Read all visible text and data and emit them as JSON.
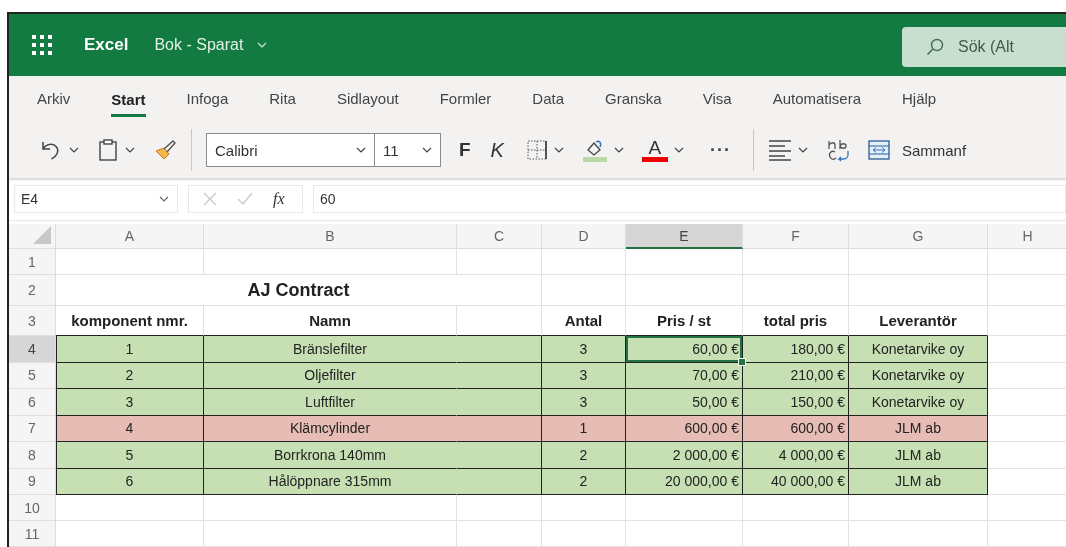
{
  "title_bar": {
    "app_name": "Excel",
    "document": "Bok - Sparat",
    "search": {
      "placeholder": "Sök (Alt"
    }
  },
  "ribbon_tabs": [
    {
      "label": "Arkiv",
      "selected": false
    },
    {
      "label": "Start",
      "selected": true
    },
    {
      "label": "Infoga",
      "selected": false
    },
    {
      "label": "Rita",
      "selected": false
    },
    {
      "label": "Sidlayout",
      "selected": false
    },
    {
      "label": "Formler",
      "selected": false
    },
    {
      "label": "Data",
      "selected": false
    },
    {
      "label": "Granska",
      "selected": false
    },
    {
      "label": "Visa",
      "selected": false
    },
    {
      "label": "Automatisera",
      "selected": false
    },
    {
      "label": "Hjälp",
      "selected": false
    }
  ],
  "toolbar": {
    "font": "Calibri",
    "font_size": "11",
    "bold": "F",
    "italic": "K",
    "font_color": "A",
    "more": "···",
    "merge": "Sammanf"
  },
  "formula_bar": {
    "name_box": "E4",
    "fx": "fx",
    "value": "60"
  },
  "sheet": {
    "columns": [
      {
        "label": "A",
        "selected": false
      },
      {
        "label": "B",
        "selected": false
      },
      {
        "label": "C",
        "selected": false
      },
      {
        "label": "D",
        "selected": false
      },
      {
        "label": "E",
        "selected": true
      },
      {
        "label": "F",
        "selected": false
      },
      {
        "label": "G",
        "selected": false
      },
      {
        "label": "H",
        "selected": false
      }
    ],
    "rows": [
      {
        "label": "1",
        "kind": "empty",
        "selected": false
      },
      {
        "label": "2",
        "kind": "title",
        "selected": false,
        "cells": {
          "A": "AJ Contract"
        }
      },
      {
        "label": "3",
        "kind": "header",
        "selected": false,
        "cells": {
          "A": "komponent nmr.",
          "B": "Namn",
          "D": "Antal",
          "E": "Pris / st",
          "F": "total pris",
          "G": "Leverantör"
        }
      },
      {
        "label": "4",
        "kind": "data",
        "selected": true,
        "color": "#c6e0b4",
        "cells": {
          "A": "1",
          "B": "Bränslefilter",
          "D": "3",
          "E": "60,00 €",
          "F": "180,00 €",
          "G": "Konetarvike oy"
        }
      },
      {
        "label": "5",
        "kind": "data",
        "selected": false,
        "color": "#c6e0b4",
        "cells": {
          "A": "2",
          "B": "Oljefilter",
          "D": "3",
          "E": "70,00 €",
          "F": "210,00 €",
          "G": "Konetarvike oy"
        }
      },
      {
        "label": "6",
        "kind": "data",
        "selected": false,
        "color": "#c6e0b4",
        "cells": {
          "A": "3",
          "B": "Luftfilter",
          "D": "3",
          "E": "50,00 €",
          "F": "150,00 €",
          "G": "Konetarvike oy"
        }
      },
      {
        "label": "7",
        "kind": "data",
        "selected": false,
        "color": "#e6bcb5",
        "cells": {
          "A": "4",
          "B": "Klämcylinder",
          "D": "1",
          "E": "600,00 €",
          "F": "600,00 €",
          "G": "JLM ab"
        }
      },
      {
        "label": "8",
        "kind": "data",
        "selected": false,
        "color": "#c6e0b4",
        "cells": {
          "A": "5",
          "B": "Borrkrona 140mm",
          "D": "2",
          "E": "2 000,00 €",
          "F": "4 000,00 €",
          "G": "JLM ab"
        }
      },
      {
        "label": "9",
        "kind": "data",
        "selected": false,
        "color": "#c6e0b4",
        "cells": {
          "A": "6",
          "B": "Hålöppnare 315mm",
          "D": "2",
          "E": "20 000,00 €",
          "F": "40 000,00 €",
          "G": "JLM ab"
        }
      },
      {
        "label": "10",
        "kind": "empty",
        "selected": false
      },
      {
        "label": "11",
        "kind": "empty",
        "selected": false
      }
    ]
  }
}
